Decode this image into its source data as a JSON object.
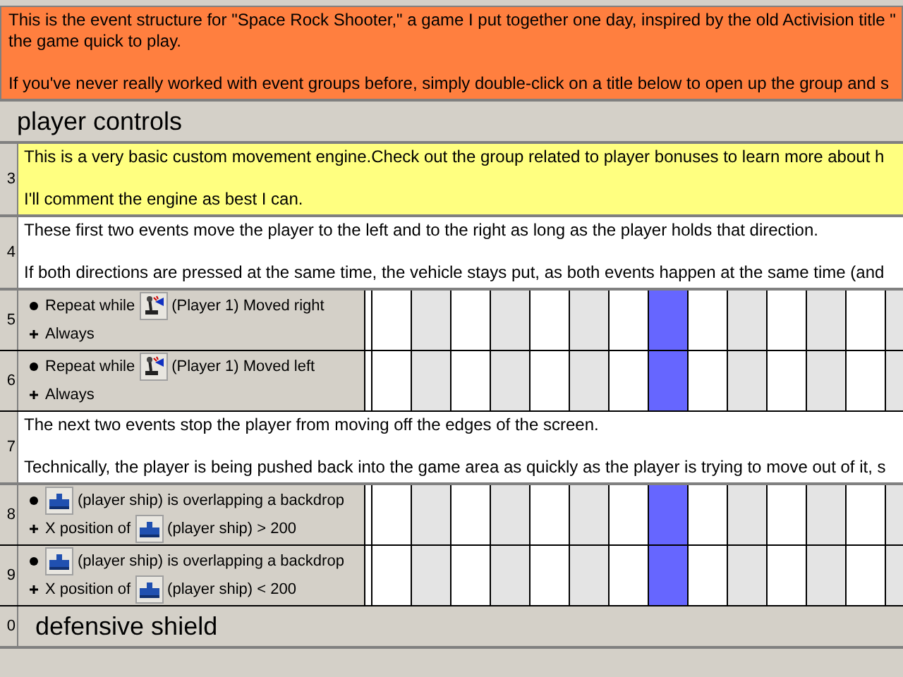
{
  "rows": [
    {
      "kind": "comment",
      "color": "#ff7f3f",
      "paragraphs": [
        [
          "This is the event structure for \"Space Rock Shooter,\" a game I put together one day, inspired by the old Activision title \"",
          "the game quick to play."
        ],
        [
          "If you've never really worked with event groups before, simply double-click on a title below to open up the group and s"
        ]
      ]
    },
    {
      "kind": "group",
      "title": "player controls"
    },
    {
      "kind": "comment",
      "color": "#ffff80",
      "number": "3",
      "paragraphs": [
        [
          "This is a very basic custom movement engine.Check out the group related to player bonuses to learn more about h"
        ],
        [
          "I'll comment the engine as best I can."
        ]
      ]
    },
    {
      "kind": "comment",
      "color": "#ffffff",
      "number": "4",
      "paragraphs": [
        [
          "These first two events move the player to the left and to the right as long as the player holds that direction."
        ],
        [
          "If both directions are pressed at the same time, the vehicle stays put, as both events happen at the same time (and"
        ]
      ]
    },
    {
      "kind": "event",
      "number": "5",
      "conditions": [
        [
          {
            "kind": "text",
            "text": "Repeat while"
          },
          {
            "kind": "joystick"
          },
          {
            "kind": "text",
            "text": "(Player 1) Moved right"
          }
        ],
        [
          {
            "kind": "text",
            "text": "Always"
          }
        ]
      ]
    },
    {
      "kind": "event",
      "number": "6",
      "conditions": [
        [
          {
            "kind": "text",
            "text": "Repeat while"
          },
          {
            "kind": "joystick"
          },
          {
            "kind": "text",
            "text": "(Player 1) Moved left"
          }
        ],
        [
          {
            "kind": "text",
            "text": "Always"
          }
        ]
      ]
    },
    {
      "kind": "comment",
      "color": "#ffffff",
      "number": "7",
      "paragraphs": [
        [
          "The next two events stop the player from moving off the edges of the screen."
        ],
        [
          "Technically, the player is being pushed back into the game area as quickly as the player is trying to move out of it, s"
        ]
      ]
    },
    {
      "kind": "event",
      "number": "8",
      "conditions": [
        [
          {
            "kind": "ship"
          },
          {
            "kind": "text",
            "text": "(player ship) is overlapping a backdrop"
          }
        ],
        [
          {
            "kind": "text",
            "text": "X position of"
          },
          {
            "kind": "ship"
          },
          {
            "kind": "text",
            "text": "(player ship) > 200"
          }
        ]
      ]
    },
    {
      "kind": "event",
      "number": "9",
      "conditions": [
        [
          {
            "kind": "ship"
          },
          {
            "kind": "text",
            "text": "(player ship) is overlapping a backdrop"
          }
        ],
        [
          {
            "kind": "text",
            "text": "X position of"
          },
          {
            "kind": "ship"
          },
          {
            "kind": "text",
            "text": "(player ship) < 200"
          }
        ]
      ]
    },
    {
      "kind": "group",
      "number": "0",
      "title": "defensive shield"
    }
  ],
  "columns": [
    {
      "selected": false
    },
    {
      "selected": false
    },
    {
      "selected": false
    },
    {
      "selected": false
    },
    {
      "selected": false
    },
    {
      "selected": false
    },
    {
      "selected": false
    },
    {
      "selected": true
    },
    {
      "selected": false
    },
    {
      "selected": false
    },
    {
      "selected": false
    },
    {
      "selected": false
    },
    {
      "selected": false
    },
    {
      "selected": false
    }
  ]
}
